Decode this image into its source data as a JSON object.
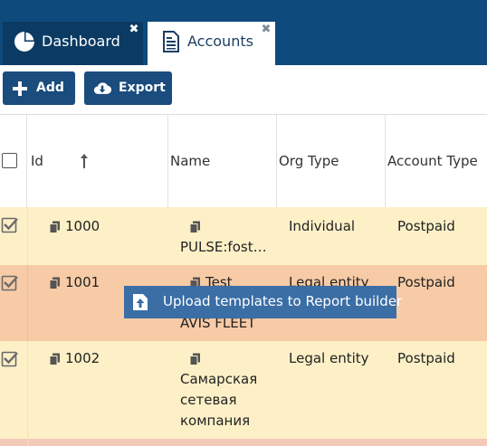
{
  "tabs": [
    {
      "label": "Dashboard",
      "icon": "pie-chart-icon",
      "active": false
    },
    {
      "label": "Accounts",
      "icon": "document-list-icon",
      "active": true
    }
  ],
  "toolbar": {
    "add_label": "Add",
    "export_label": "Export"
  },
  "table": {
    "columns": [
      "Id",
      "Name",
      "Org Type",
      "Account Type"
    ],
    "sort": {
      "column": "Id",
      "direction": "ascending"
    },
    "rows": [
      {
        "id": "1000",
        "name_lines": [
          "PULSE:fost…"
        ],
        "org_type": "Individual",
        "account_type": "Postpaid",
        "checked": true
      },
      {
        "id": "1001",
        "name_lines": [
          "Test",
          "AVIS FLEET"
        ],
        "org_type": "Legal entity",
        "account_type": "Postpaid",
        "checked": true
      },
      {
        "id": "1002",
        "name_lines": [
          "Самарская",
          "сетевая",
          "компания"
        ],
        "org_type": "Legal entity",
        "account_type": "Postpaid",
        "checked": true
      }
    ]
  },
  "tooltip": {
    "text": "Upload templates to Report builder",
    "icon": "upload-icon"
  },
  "colors": {
    "header_bar": "#0f4a7c",
    "button": "#1a4c7e",
    "row_checked": "#fdf0c7",
    "row_hover": "#f7cba6",
    "tooltip": "#3a6ea5"
  }
}
